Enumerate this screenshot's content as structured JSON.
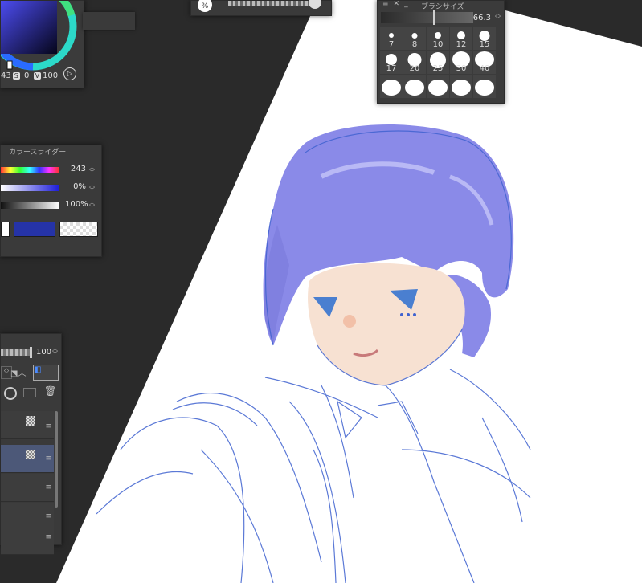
{
  "color_panel": {
    "hsv_h": "43",
    "hsv_s_tag": "S",
    "hsv_s": "0",
    "hsv_v_tag": "V",
    "hsv_v": "100",
    "play_icon": "▷"
  },
  "opacity_top": {
    "percent_icon": "%"
  },
  "brush_size": {
    "title": "ブラシサイズ",
    "value": "66.3",
    "presets": [
      "7",
      "8",
      "10",
      "12",
      "15",
      "17",
      "20",
      "25",
      "30",
      "40"
    ]
  },
  "color_slider": {
    "title": "カラースライダー",
    "hue": "243",
    "saturation": "0%",
    "brightness": "100%"
  },
  "layer_panel": {
    "opacity_value": "100"
  },
  "colors": {
    "hair": "#8a8ae8",
    "line": "#3f62d0",
    "skin": "#f7e1d2",
    "main_color": "#2533a8"
  }
}
